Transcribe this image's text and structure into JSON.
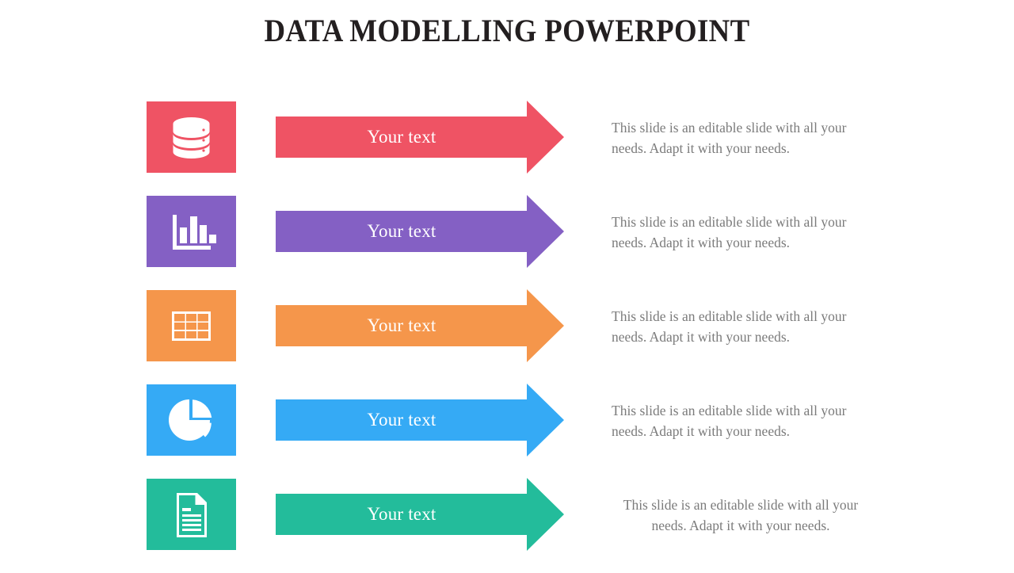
{
  "slide": {
    "title": "DATA MODELLING POWERPOINT",
    "background_color": "#FFFFFF",
    "title_color": "#231F20",
    "body_text_color": "#7B7B7B",
    "label_text_color": "#FFFFFF"
  },
  "rows": [
    {
      "icon": "database-icon",
      "color": "#EF5364",
      "label": "Your text",
      "description": "This slide is an editable slide with all your needs. Adapt it with your needs.",
      "align": "left"
    },
    {
      "icon": "bar-chart-icon",
      "color": "#8460C4",
      "label": "Your text",
      "description": "This slide is an editable slide with all your needs. Adapt it with your needs.",
      "align": "left"
    },
    {
      "icon": "table-grid-icon",
      "color": "#F5964B",
      "label": "Your text",
      "description": "This slide is an editable slide with all your needs. Adapt it with your needs.",
      "align": "left"
    },
    {
      "icon": "pie-chart-icon",
      "color": "#35AAF5",
      "label": "Your text",
      "description": "This slide is an editable slide with all your needs. Adapt it with your needs.",
      "align": "left"
    },
    {
      "icon": "document-icon",
      "color": "#23BC9B",
      "label": "Your text",
      "description": "This slide is an editable slide with all your needs. Adapt it with your needs.",
      "align": "center"
    }
  ]
}
